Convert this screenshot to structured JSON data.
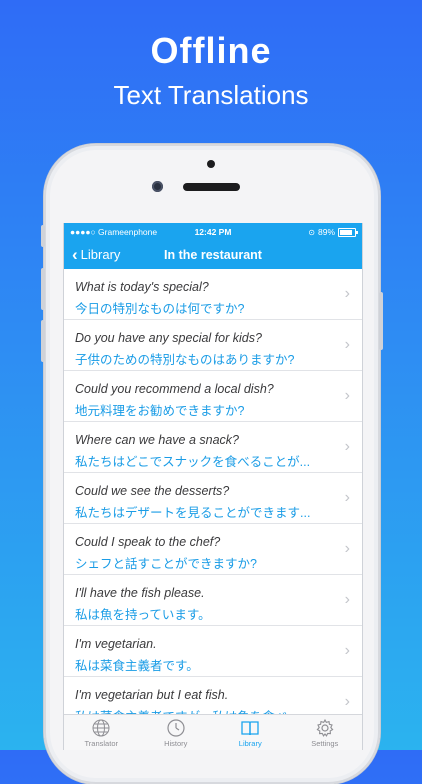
{
  "promo": {
    "headline": "Offline",
    "subheadline": "Text Translations"
  },
  "status": {
    "carrier": "●●●●○ Grameenphone",
    "time": "12:42 PM",
    "battery": "89%"
  },
  "nav": {
    "back_label": "Library",
    "title": "In the restaurant"
  },
  "phrases": [
    {
      "en": "What is today's special?",
      "ja": "今日の特別なものは何ですか?"
    },
    {
      "en": "Do you have any special for kids?",
      "ja": "子供のための特別なものはありますか?"
    },
    {
      "en": "Could you recommend a local dish?",
      "ja": "地元料理をお勧めできますか?"
    },
    {
      "en": "Where can we have a snack?",
      "ja": "私たちはどこでスナックを食べることが..."
    },
    {
      "en": "Could we see the desserts?",
      "ja": "私たちはデザートを見ることができます..."
    },
    {
      "en": "Could I speak to the chef?",
      "ja": "シェフと話すことができますか?"
    },
    {
      "en": "I'll have the fish please.",
      "ja": "私は魚を持っています。"
    },
    {
      "en": "I'm vegetarian.",
      "ja": "私は菜食主義者です。"
    },
    {
      "en": "I'm vegetarian but I eat fish.",
      "ja": "私は菜食主義者ですが、私は魚を食べ..."
    }
  ],
  "tabs": [
    {
      "label": "Translator",
      "icon": "globe-icon",
      "active": false
    },
    {
      "label": "History",
      "icon": "clock-icon",
      "active": false
    },
    {
      "label": "Library",
      "icon": "book-icon",
      "active": true
    },
    {
      "label": "Settings",
      "icon": "gear-icon",
      "active": false
    }
  ],
  "colors": {
    "accent": "#1aa4ef",
    "japanese_text": "#1a9ce6"
  }
}
